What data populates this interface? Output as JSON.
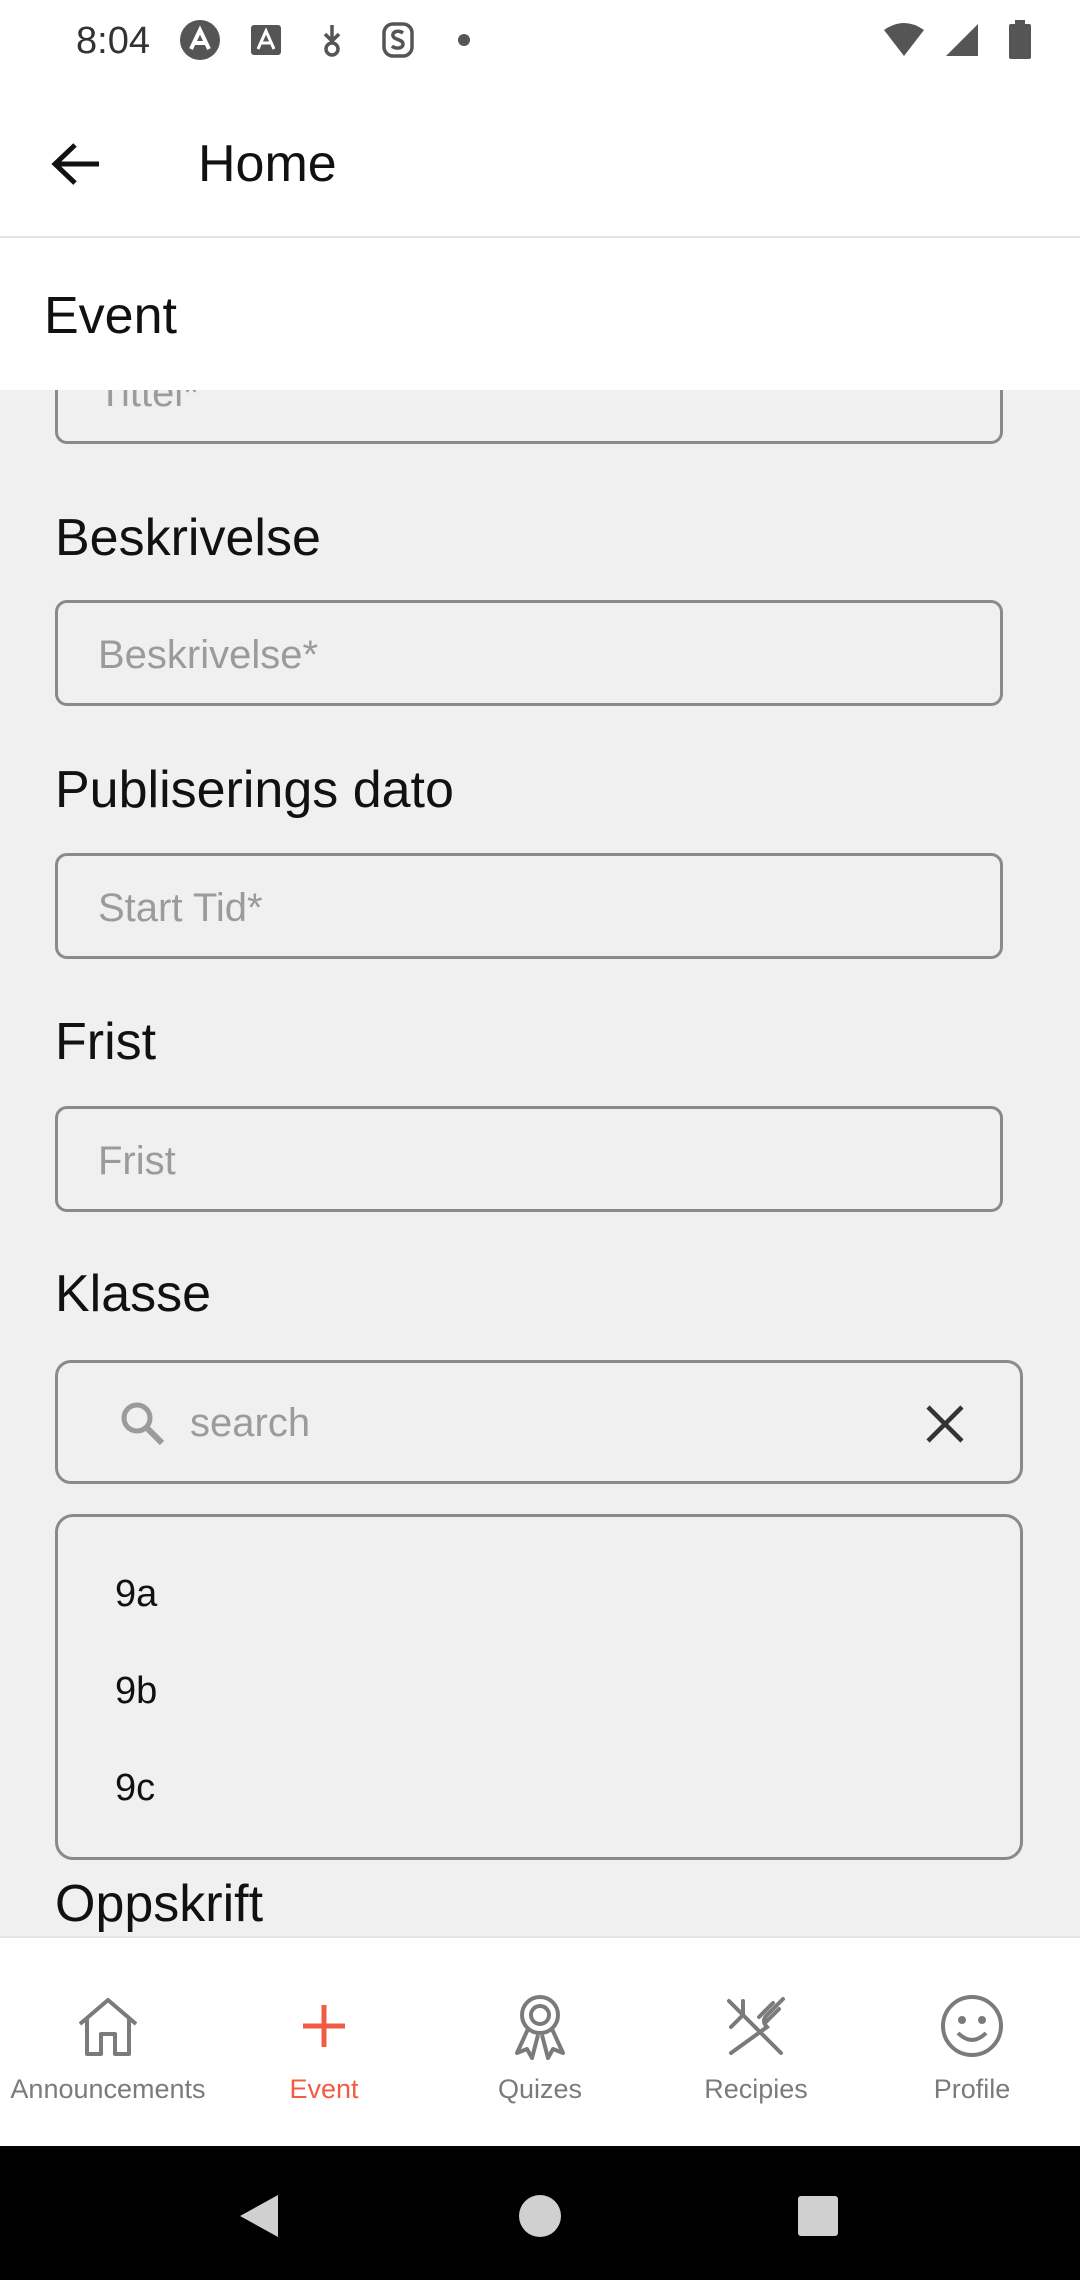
{
  "status_bar": {
    "time": "8:04",
    "left_icons": [
      "app-a-icon",
      "text-a-icon",
      "download-badge-icon",
      "s-app-icon",
      "dot-icon"
    ],
    "right_icons": [
      "wifi-icon",
      "signal-icon",
      "battery-icon"
    ]
  },
  "app_bar": {
    "title": "Home"
  },
  "section": {
    "title": "Event"
  },
  "form": {
    "title_field": {
      "placeholder": "Tittel*"
    },
    "description": {
      "label": "Beskrivelse",
      "placeholder": "Beskrivelse*"
    },
    "publish_date": {
      "label": "Publiserings dato",
      "placeholder": "Start Tid*"
    },
    "deadline": {
      "label": "Frist",
      "placeholder": "Frist"
    },
    "class": {
      "label": "Klasse",
      "search_placeholder": "search",
      "options": [
        "9a",
        "9b",
        "9c"
      ]
    },
    "recipe": {
      "label": "Oppskrift"
    }
  },
  "bottom_nav": {
    "items": [
      {
        "label": "Announcements",
        "icon": "home-icon"
      },
      {
        "label": "Event",
        "icon": "plus-icon",
        "active": true
      },
      {
        "label": "Quizes",
        "icon": "award-icon"
      },
      {
        "label": "Recipies",
        "icon": "utensils-icon"
      },
      {
        "label": "Profile",
        "icon": "smiley-icon"
      }
    ]
  },
  "colors": {
    "accent": "#f25c45",
    "background": "#f0f0f0",
    "border": "#8a8a8a",
    "placeholder": "#9b9b9b"
  }
}
